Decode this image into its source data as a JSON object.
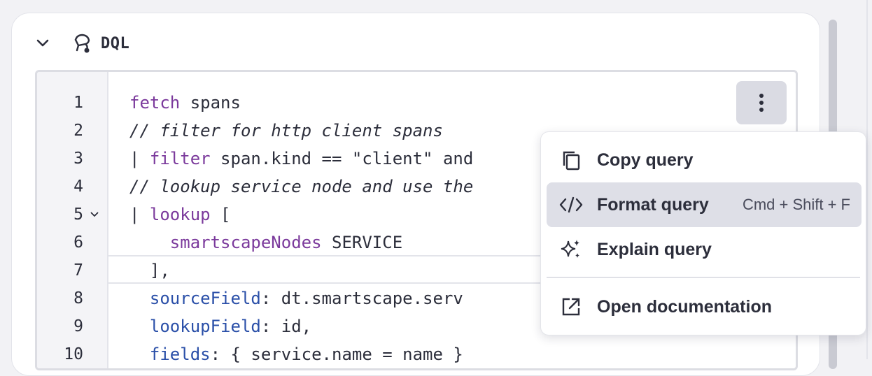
{
  "section": {
    "title": "DQL"
  },
  "editor": {
    "line_numbers": [
      "1",
      "2",
      "3",
      "4",
      "5",
      "6",
      "7",
      "8",
      "9",
      "10"
    ],
    "lines": [
      [
        {
          "t": "fetch",
          "c": "kw"
        },
        {
          "t": " spans",
          "c": ""
        }
      ],
      [
        {
          "t": "// filter for http client spans",
          "c": "cm"
        }
      ],
      [
        {
          "t": "| ",
          "c": ""
        },
        {
          "t": "filter",
          "c": "kw"
        },
        {
          "t": " span.kind == \"client\" and",
          "c": ""
        }
      ],
      [
        {
          "t": "// lookup service node and use the",
          "c": "cm"
        }
      ],
      [
        {
          "t": "| ",
          "c": ""
        },
        {
          "t": "lookup",
          "c": "kw"
        },
        {
          "t": " [",
          "c": ""
        }
      ],
      [
        {
          "t": "    ",
          "c": ""
        },
        {
          "t": "smartscapeNodes",
          "c": "kw"
        },
        {
          "t": " SERVICE",
          "c": ""
        }
      ],
      [
        {
          "t": "  ],",
          "c": ""
        }
      ],
      [
        {
          "t": "  ",
          "c": ""
        },
        {
          "t": "sourceField",
          "c": "fld"
        },
        {
          "t": ": dt.smartscape.serv",
          "c": ""
        }
      ],
      [
        {
          "t": "  ",
          "c": ""
        },
        {
          "t": "lookupField",
          "c": "fld"
        },
        {
          "t": ": id,",
          "c": ""
        }
      ],
      [
        {
          "t": "  ",
          "c": ""
        },
        {
          "t": "fields",
          "c": "fld"
        },
        {
          "t": ": { service.name = name }",
          "c": ""
        }
      ]
    ]
  },
  "menu": {
    "items": [
      {
        "label": "Copy query",
        "icon": "copy-icon",
        "shortcut": ""
      },
      {
        "label": "Format query",
        "icon": "code-icon",
        "shortcut": "Cmd + Shift + F"
      },
      {
        "label": "Explain query",
        "icon": "sparkle-icon",
        "shortcut": ""
      },
      {
        "label": "Open documentation",
        "icon": "external-link-icon",
        "shortcut": ""
      }
    ]
  },
  "colors": {
    "keyword": "#7b3a9c",
    "field": "#2a4fa8",
    "text": "#2c2e3b",
    "menu_highlight": "#dedfe7"
  }
}
